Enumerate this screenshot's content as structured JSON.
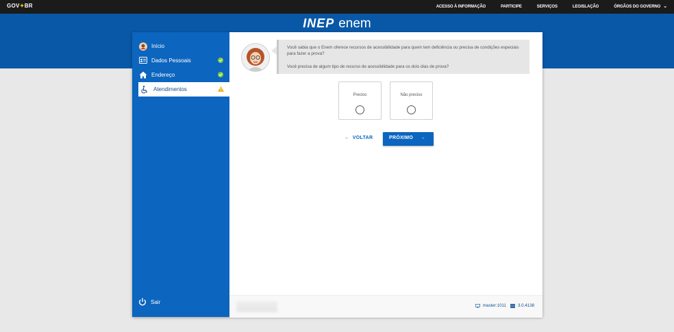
{
  "topbar": {
    "logo_left": "GOV",
    "logo_right": "BR",
    "links": [
      "ACESSO À INFORMAÇÃO",
      "PARTICIPE",
      "SERVIÇOS",
      "LEGISLAÇÃO",
      "ÓRGÃOS DO GOVERNO"
    ]
  },
  "brand": {
    "inep": "INEP",
    "enem": "enem"
  },
  "sidebar": {
    "items": [
      {
        "label": "Início",
        "icon": "user-avatar-icon"
      },
      {
        "label": "Dados Pessoais",
        "icon": "id-card-icon",
        "status": "complete"
      },
      {
        "label": "Endereço",
        "icon": "home-icon",
        "status": "complete"
      },
      {
        "label": "Atendimentos",
        "icon": "wheelchair-icon",
        "status": "warning"
      }
    ],
    "logout": "Sair"
  },
  "content": {
    "bubble_text_1": "Você sabia que o Enem oferece recursos de acessibilidade para quem tem deficiência ou precisa de condições especiais para fazer a prova?",
    "bubble_text_2": "Você precisa de algum tipo de recurso de acessibilidade para os dois dias de prova?",
    "options": [
      "Preciso",
      "Não preciso"
    ],
    "back_label": "VOLTAR",
    "next_label": "PRÓXIMO"
  },
  "footer": {
    "server": "master:1011",
    "version": "3.0.4138"
  },
  "colors": {
    "primary": "#0c65be",
    "header": "#0958a8",
    "topbar": "#1b1b1b",
    "success": "#5cb85c",
    "warning": "#f0ad1e"
  }
}
